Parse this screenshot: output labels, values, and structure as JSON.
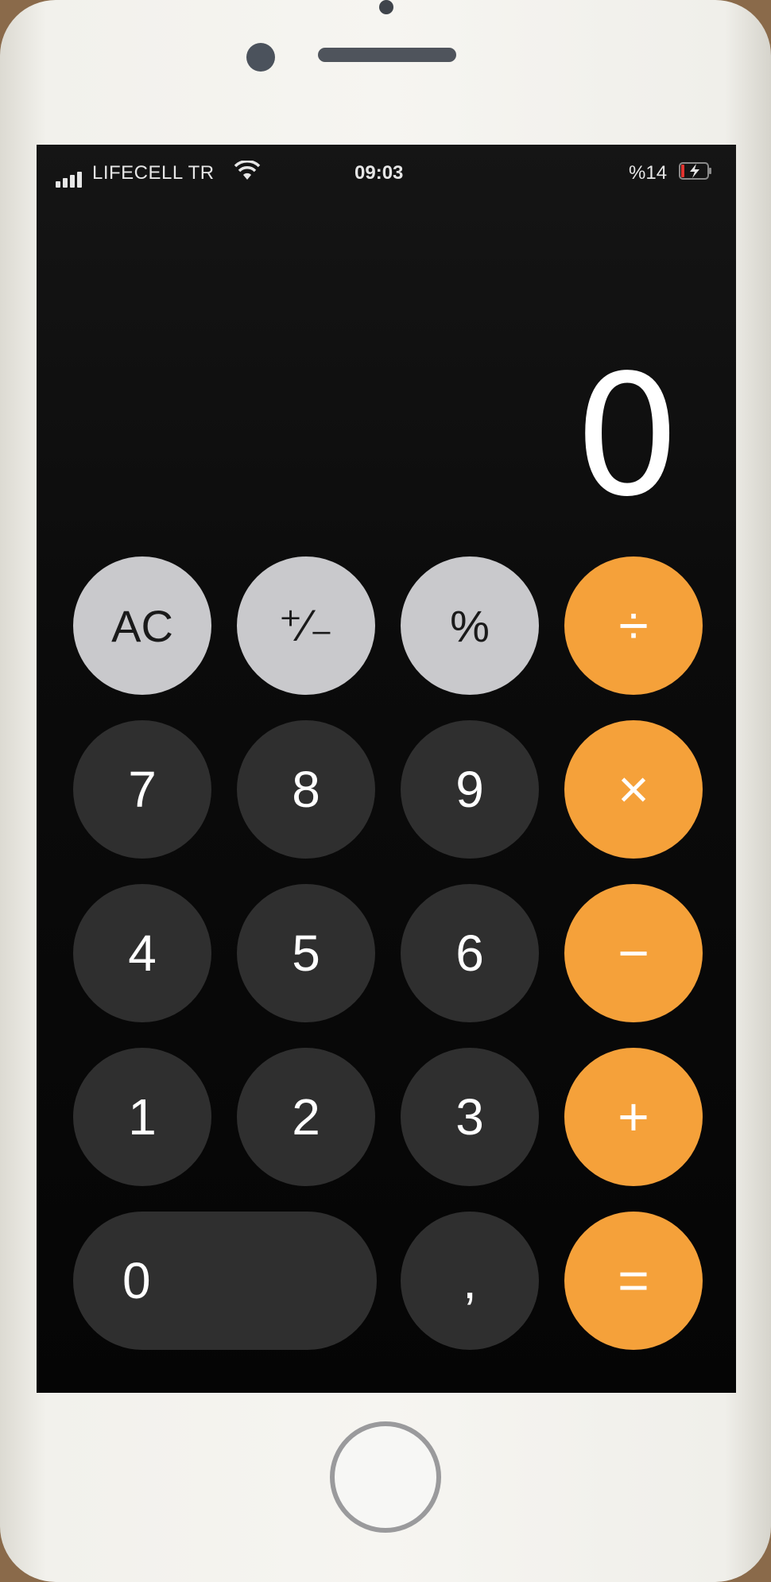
{
  "status_bar": {
    "carrier": "LIFECELL TR",
    "time": "09:03",
    "battery_percent": "%14",
    "signal_icon": "signal-bars-icon",
    "wifi_icon": "wifi-icon",
    "battery_icon": "battery-charging-icon"
  },
  "display": {
    "value": "0"
  },
  "keys": {
    "ac": "AC",
    "plus_minus": "⁺∕₋",
    "percent": "%",
    "divide": "÷",
    "seven": "7",
    "eight": "8",
    "nine": "9",
    "multiply": "×",
    "four": "4",
    "five": "5",
    "six": "6",
    "minus": "−",
    "one": "1",
    "two": "2",
    "three": "3",
    "plus": "+",
    "zero": "0",
    "decimal": ",",
    "equals": "="
  },
  "colors": {
    "operator": "#f5a13a",
    "function": "#c9c9cc",
    "digit": "#2f2f2f",
    "background": "#000000"
  }
}
